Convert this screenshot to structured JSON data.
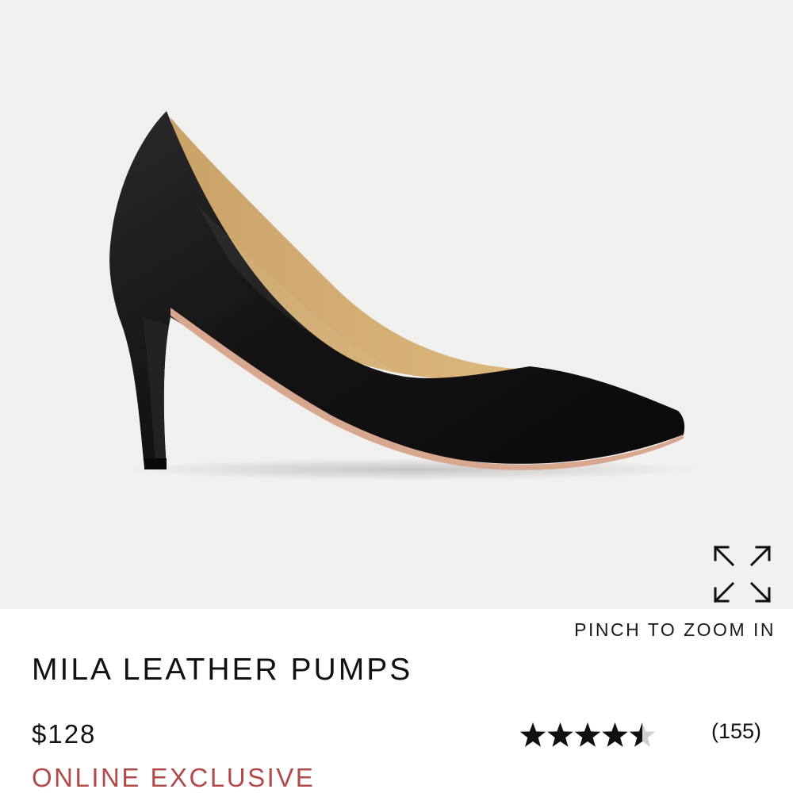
{
  "product": {
    "name": "MILA LEATHER PUMPS",
    "price": "$128",
    "badge": "ONLINE EXCLUSIVE",
    "rating": 4.5,
    "rating_max": 5,
    "review_count": "(155)"
  },
  "image": {
    "zoom_hint": "PINCH TO ZOOM IN",
    "zoom_icon": "expand-arrows-icon",
    "background_color": "#f0f0ee"
  },
  "colors": {
    "badge": "#b24a4c",
    "star_filled": "#111111",
    "star_empty": "#cfcfcf"
  }
}
